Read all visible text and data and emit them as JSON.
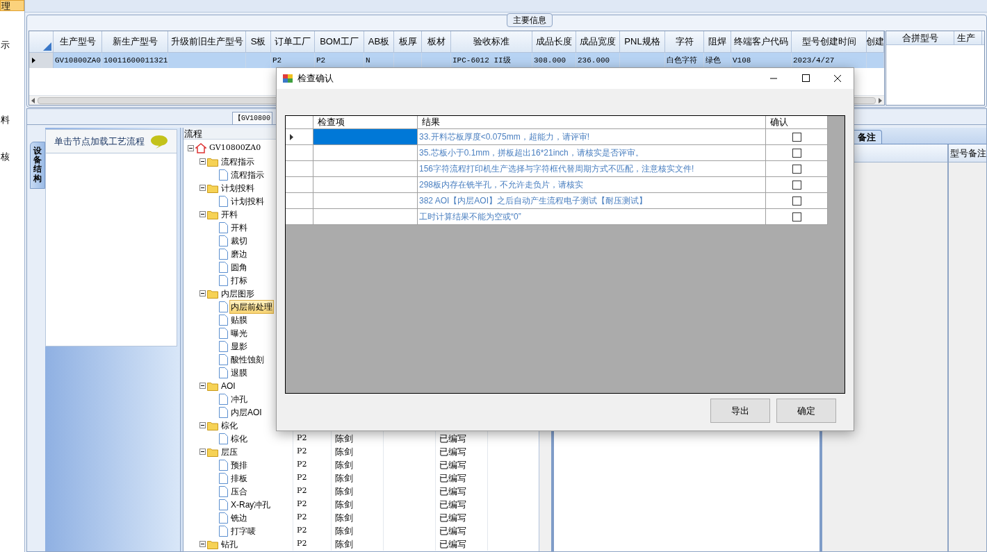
{
  "nav": [
    {
      "label": "理",
      "selected": true
    },
    {
      "label": "示",
      "selected": false
    },
    {
      "label": "料",
      "selected": false
    },
    {
      "label": "核",
      "selected": false
    }
  ],
  "main_info": {
    "title": "主要信息",
    "columns": [
      "生产型号",
      "新生产型号",
      "升级前旧生产型号",
      "S板",
      "订单工厂",
      "BOM工厂",
      "AB板",
      "板厚",
      "板材",
      "验收标准",
      "成品长度",
      "成品宽度",
      "PNL规格",
      "字符",
      "阻焊",
      "终端客户代码",
      "型号创建时间",
      "创建"
    ],
    "rows": [
      {
        "selected": true,
        "cells": [
          "GV10800ZA0",
          "10011600011321",
          null,
          null,
          "P2",
          "P2",
          "N",
          null,
          null,
          "IPC-6012 II级",
          "308.000",
          "236.000",
          null,
          "白色字符",
          "绿色",
          "V108",
          "2023/4/27",
          null
        ]
      }
    ],
    "side_columns": [
      "合拼型号",
      "生产"
    ]
  },
  "lower_tab": "【GV10800",
  "side_tab": "设备结构",
  "hint": "单击节点加载工艺流程",
  "tree": {
    "header": "流程",
    "root": {
      "kind": "folder",
      "label": "GV10800ZA0",
      "expanded": true,
      "children": [
        {
          "kind": "folder",
          "label": "流程指示",
          "expanded": true,
          "children": [
            {
              "kind": "leaf",
              "label": "流程指示",
              "selected": false
            }
          ]
        },
        {
          "kind": "folder",
          "label": "计划投料",
          "expanded": true,
          "children": [
            {
              "kind": "leaf",
              "label": "计划投料",
              "selected": false
            }
          ]
        },
        {
          "kind": "folder",
          "label": "开料",
          "expanded": true,
          "children": [
            {
              "kind": "leaf",
              "label": "开料",
              "selected": false
            },
            {
              "kind": "leaf",
              "label": "裁切",
              "selected": false
            },
            {
              "kind": "leaf",
              "label": "磨边",
              "selected": false
            },
            {
              "kind": "leaf",
              "label": "圆角",
              "selected": false
            },
            {
              "kind": "leaf",
              "label": "打标",
              "selected": false
            }
          ]
        },
        {
          "kind": "folder",
          "label": "内层图形",
          "expanded": true,
          "children": [
            {
              "kind": "leaf",
              "label": "内层前处理",
              "selected": true
            },
            {
              "kind": "leaf",
              "label": "贴膜",
              "selected": false
            },
            {
              "kind": "leaf",
              "label": "曝光",
              "selected": false
            },
            {
              "kind": "leaf",
              "label": "显影",
              "selected": false
            },
            {
              "kind": "leaf",
              "label": "酸性蚀刻",
              "selected": false
            },
            {
              "kind": "leaf",
              "label": "退膜",
              "selected": false
            }
          ]
        },
        {
          "kind": "folder",
          "label": "AOI",
          "expanded": true,
          "children": [
            {
              "kind": "leaf",
              "label": "冲孔",
              "selected": false
            },
            {
              "kind": "leaf",
              "label": "内层AOI",
              "selected": false
            }
          ]
        },
        {
          "kind": "folder",
          "label": "棕化",
          "expanded": true,
          "children": [
            {
              "kind": "leaf",
              "label": "棕化",
              "selected": false,
              "factory": "P2",
              "owner": "陈剑",
              "status": "已编写"
            }
          ]
        },
        {
          "kind": "folder",
          "label": "层压",
          "expanded": true,
          "factory": "P2",
          "owner": "陈剑",
          "status": "已编写",
          "children": [
            {
              "kind": "leaf",
              "label": "预排",
              "selected": false,
              "factory": "P2",
              "owner": "陈剑",
              "status": "已编写"
            },
            {
              "kind": "leaf",
              "label": "排板",
              "selected": false,
              "factory": "P2",
              "owner": "陈剑",
              "status": "已编写"
            },
            {
              "kind": "leaf",
              "label": "压合",
              "selected": false,
              "factory": "P2",
              "owner": "陈剑",
              "status": "已编写"
            },
            {
              "kind": "leaf",
              "label": "X-Ray冲孔",
              "selected": false,
              "factory": "P2",
              "owner": "陈剑",
              "status": "已编写"
            },
            {
              "kind": "leaf",
              "label": "铣边",
              "selected": false,
              "factory": "P2",
              "owner": "陈剑",
              "status": "已编写"
            },
            {
              "kind": "leaf",
              "label": "打字唛",
              "selected": false,
              "factory": "P2",
              "owner": "陈剑",
              "status": "已编写"
            }
          ]
        },
        {
          "kind": "folder",
          "label": "钻孔",
          "expanded": true,
          "factory": "P2",
          "owner": "陈剑",
          "status": "已编写"
        }
      ]
    }
  },
  "remarks": {
    "tab": "备注",
    "column": "型号备注"
  },
  "dialog": {
    "title": "检查确认",
    "columns": [
      "检查项",
      "结果",
      "确认"
    ],
    "rows": [
      {
        "selected": true,
        "result": "33.开料芯板厚度<0.075mm，超能力，请评审!",
        "checked": false
      },
      {
        "selected": false,
        "result": "35.芯板小于0.1mm，拼板超出16*21inch，请核实是否评审。",
        "checked": false
      },
      {
        "selected": false,
        "result": "156字符流程打印机生产选择与字符框代替周期方式不匹配，注意核实文件!",
        "checked": false
      },
      {
        "selected": false,
        "result": "298板内存在铣半孔，不允许走负片，请核实",
        "checked": false
      },
      {
        "selected": false,
        "result": "382 AOI【内层AOI】之后自动产生流程电子测试【耐压测试】",
        "checked": false
      },
      {
        "selected": false,
        "result": "工时计算结果不能为空或“0”",
        "checked": false
      }
    ],
    "buttons": [
      "导出",
      "确定"
    ]
  }
}
